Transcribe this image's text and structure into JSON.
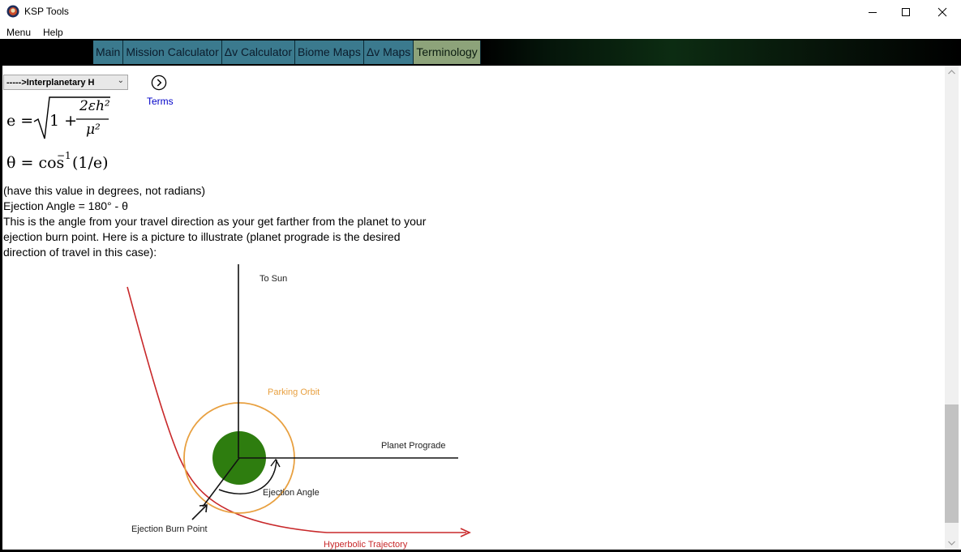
{
  "window": {
    "title": "KSP Tools",
    "icon": "ksp-app-icon"
  },
  "menu": {
    "items": [
      "Menu",
      "Help"
    ]
  },
  "nav": {
    "tabs": [
      {
        "label": "Main",
        "active": false
      },
      {
        "label": "Mission Calculator",
        "active": false
      },
      {
        "label": "Δv Calculator",
        "active": false
      },
      {
        "label": "Biome Maps",
        "active": false
      },
      {
        "label": "Δv Maps",
        "active": false
      },
      {
        "label": "Terminology",
        "active": true
      }
    ]
  },
  "toolbar": {
    "topic_selected": "----->Interplanetary H",
    "next_icon": "chevron-right-circle-icon",
    "next_label": "Terms"
  },
  "equations": {
    "eccentricity": {
      "lhs": "e =",
      "one_plus": "1 +",
      "numerator": "2εh²",
      "denominator": "μ²"
    },
    "theta": {
      "lhs": "θ = cos",
      "exponent": "−1",
      "argument": "(1/e)"
    }
  },
  "text": {
    "line1": "(have this value in degrees, not radians)",
    "line2": "Ejection Angle = 180° - θ",
    "line3": "This is the angle from your travel direction as your get farther from the planet to your",
    "line4": "ejection burn point. Here is a picture to illustrate (planet prograde is the desired",
    "line5": "direction of travel in this case):"
  },
  "diagram": {
    "to_sun": "To Sun",
    "parking_orbit": "Parking Orbit",
    "planet_prograde": "Planet Prograde",
    "ejection_angle": "Ejection Angle",
    "ejection_burn_point": "Ejection Burn Point",
    "hyperbolic_trajectory": "Hyperbolic Trajectory",
    "colors": {
      "planet": "#2e7d0f",
      "orbit": "#e8a040",
      "trajectory": "#c8282a",
      "axes": "#111111"
    }
  }
}
